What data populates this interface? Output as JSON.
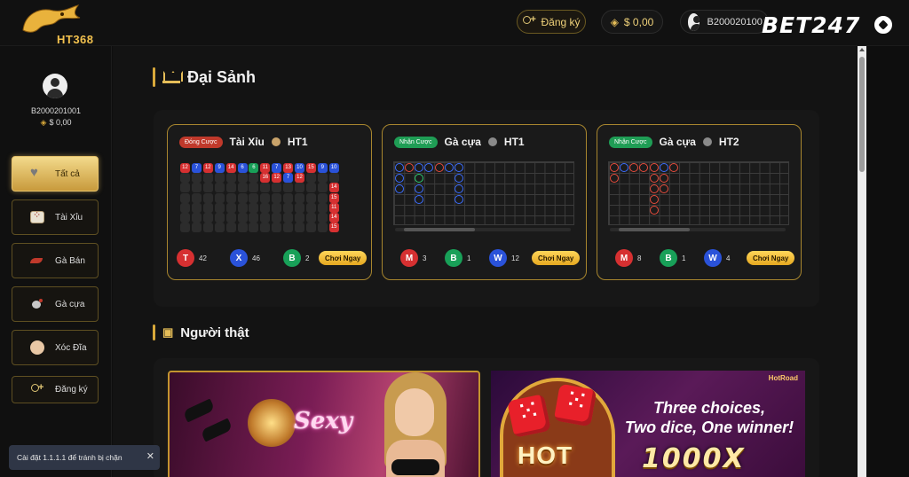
{
  "header": {
    "logo_text": "HT368",
    "register_label": "Đăng ký",
    "balance": "$ 0,00",
    "account_id": "B2000201001",
    "watermark": "BET247"
  },
  "sidebar": {
    "profile_name": "B2000201001",
    "profile_balance": "$ 0,00",
    "items": [
      {
        "label": "Tất cả",
        "icon": "heart-icon",
        "active": true
      },
      {
        "label": "Tài Xỉu",
        "icon": "dice-icon"
      },
      {
        "label": "Gà Bán",
        "icon": "fish-icon"
      },
      {
        "label": "Gà cựa",
        "icon": "rooster-icon"
      },
      {
        "label": "Xóc Đĩa",
        "icon": "lady-icon"
      },
      {
        "label": "Đăng ký",
        "icon": "add-user-icon"
      }
    ]
  },
  "lobby": {
    "title": "Đại Sảnh",
    "cards": [
      {
        "badge": "Đóng Cược",
        "title": "Tài Xỉu",
        "table": "HT1",
        "cells": [
          [
            "12",
            "red"
          ],
          [
            "7",
            "blue"
          ],
          [
            "12",
            "red"
          ],
          [
            "9",
            "blue"
          ],
          [
            "14",
            "red"
          ],
          [
            "6",
            "blue"
          ],
          [
            "6",
            "green"
          ],
          [
            "11",
            "red"
          ],
          [
            "7",
            "blue"
          ],
          [
            "13",
            "red"
          ],
          [
            "10",
            "blue"
          ],
          [
            "15",
            "red"
          ],
          [
            "9",
            "blue"
          ],
          [
            "10",
            "blue"
          ],
          [
            "16",
            "red"
          ],
          [
            "12",
            "red"
          ],
          [
            "7",
            "blue"
          ],
          [
            "12",
            "red"
          ],
          [
            "14",
            "red"
          ],
          [
            "15",
            "red"
          ],
          [
            "11",
            "red"
          ],
          [
            "14",
            "red"
          ],
          [
            "15",
            "red"
          ]
        ],
        "stats": [
          {
            "label": "T",
            "value": "42",
            "color": "red"
          },
          {
            "label": "X",
            "value": "46",
            "color": "blue"
          },
          {
            "label": "B",
            "value": "2",
            "color": "green"
          }
        ],
        "play": "Chơi Ngay"
      },
      {
        "badge": "Nhận Cược",
        "title": "Gà cựa",
        "table": "HT1",
        "stats": [
          {
            "label": "M",
            "value": "3",
            "color": "red"
          },
          {
            "label": "B",
            "value": "1",
            "color": "green"
          },
          {
            "label": "W",
            "value": "12",
            "color": "blue"
          }
        ],
        "play": "Chơi Ngay"
      },
      {
        "badge": "Nhận Cược",
        "title": "Gà cựa",
        "table": "HT2",
        "stats": [
          {
            "label": "M",
            "value": "8",
            "color": "red"
          },
          {
            "label": "B",
            "value": "1",
            "color": "green"
          },
          {
            "label": "W",
            "value": "4",
            "color": "blue"
          }
        ],
        "play": "Chơi Ngay"
      }
    ]
  },
  "live": {
    "title": "Người thật",
    "banner1_text": "Sexy",
    "banner2_line1": "Three choices,",
    "banner2_line2": "Two dice, One winner!",
    "banner2_hot": "HOT",
    "banner2_multiplier": "1000X",
    "banner2_brand": "HotRoad"
  },
  "toast": {
    "message": "Cài đặt 1.1.1.1 để tránh bị chặn",
    "close": "✕"
  },
  "colors": {
    "accent": "#d9a93a",
    "red": "#d63031",
    "blue": "#2a52d9",
    "green": "#18a058"
  }
}
